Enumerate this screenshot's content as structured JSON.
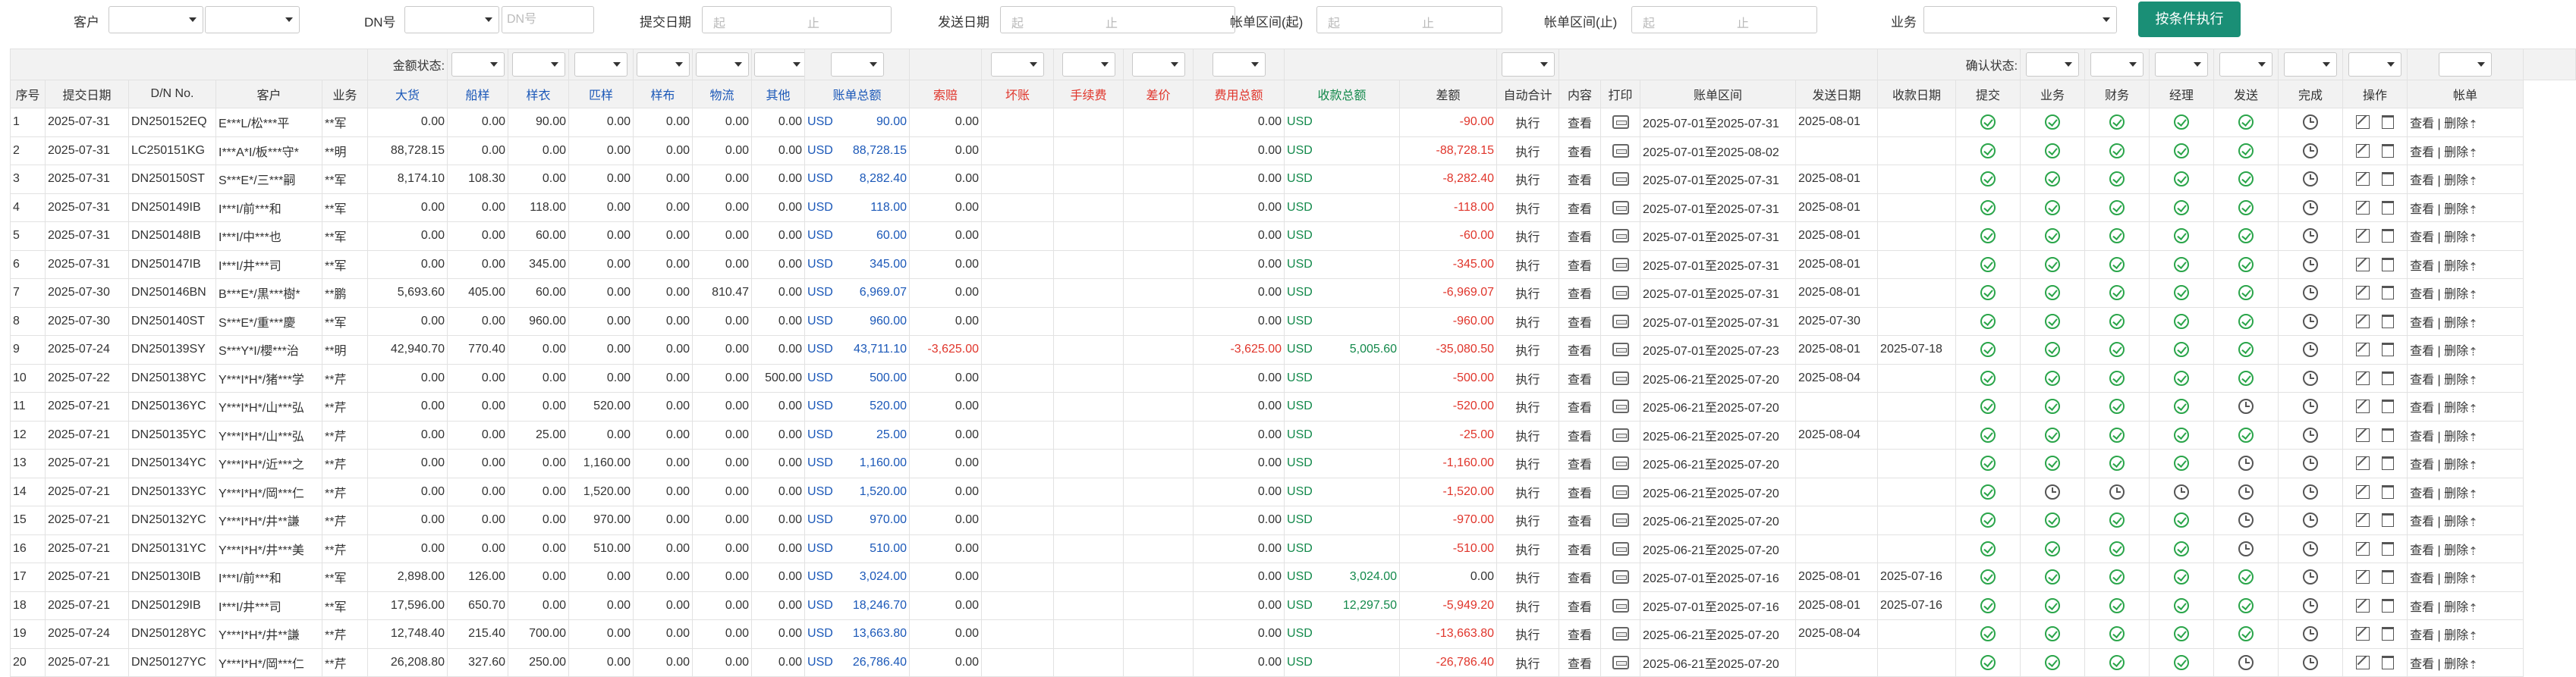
{
  "filters": {
    "customer_label": "客户",
    "dn_label": "DN号",
    "dn_placeholder": "DN号",
    "submit_date_label": "提交日期",
    "ship_date_label": "发送日期",
    "bill_start_label": "帐单区间(起)",
    "bill_end_label": "帐单区间(止)",
    "business_label": "业务",
    "range_from": "起",
    "range_to": "止",
    "execute_button": "按条件执行"
  },
  "header1": {
    "amount_status": "金额状态:",
    "confirm_status": "确认状态:"
  },
  "columns": {
    "seq": "序号",
    "submit_date": "提交日期",
    "dn": "D/N No.",
    "customer": "客户",
    "business": "业务",
    "bulk": "大货",
    "ship_sample": "船样",
    "sample": "样衣",
    "swatch": "匹样",
    "fabric_sample": "样布",
    "logistics": "物流",
    "other": "其他",
    "bill_total": "账单总额",
    "claim": "索赔",
    "bad_debt": "坏账",
    "fee": "手续费",
    "diff_price": "差价",
    "fee_total": "费用总额",
    "received_total": "收款总额",
    "balance": "差额",
    "auto_sum": "自动合计",
    "content": "内容",
    "print": "打印",
    "bill_range": "账单区间",
    "ship_date": "发送日期",
    "receive_date": "收款日期",
    "c_submit": "提交",
    "c_business": "业务",
    "c_finance": "财务",
    "c_manager": "经理",
    "c_send": "发送",
    "c_done": "完成",
    "ops": "操作",
    "statement": "帐单"
  },
  "labels": {
    "auto": "执行",
    "view": "查看",
    "op_text": "查看 | 删除",
    "currency": "USD"
  },
  "colors": {
    "accent": "#1a8f76",
    "blue": "#1b58b8",
    "red": "#e0352b",
    "green": "#13894b"
  },
  "rows": [
    {
      "seq": "1",
      "date": "2025-07-31",
      "dn": "DN250152EQ",
      "cust": "E***L/松***平",
      "biz": "**军",
      "bulk": "0.00",
      "ship": "0.00",
      "sample": "90.00",
      "swatch": "0.00",
      "fabric": "0.00",
      "log": "0.00",
      "other": "0.00",
      "total": "90.00",
      "claim": "0.00",
      "feetotal": "0.00",
      "recv": "",
      "bal": "-90.00",
      "range": "2025-07-01至2025-07-31",
      "ship_date": "2025-08-01",
      "recv_date": "",
      "status": [
        "c",
        "c",
        "c",
        "c",
        "c",
        "k"
      ]
    },
    {
      "seq": "2",
      "date": "2025-07-31",
      "dn": "LC250151KG",
      "cust": "I***A*I/板***守*",
      "biz": "**明",
      "bulk": "88,728.15",
      "ship": "0.00",
      "sample": "0.00",
      "swatch": "0.00",
      "fabric": "0.00",
      "log": "0.00",
      "other": "0.00",
      "total": "88,728.15",
      "claim": "0.00",
      "feetotal": "0.00",
      "recv": "",
      "bal": "-88,728.15",
      "range": "2025-07-01至2025-08-02",
      "ship_date": "",
      "recv_date": "",
      "status": [
        "c",
        "c",
        "c",
        "c",
        "c",
        "k"
      ]
    },
    {
      "seq": "3",
      "date": "2025-07-31",
      "dn": "DN250150ST",
      "cust": "S***E*/三***嗣",
      "biz": "**军",
      "bulk": "8,174.10",
      "ship": "108.30",
      "sample": "0.00",
      "swatch": "0.00",
      "fabric": "0.00",
      "log": "0.00",
      "other": "0.00",
      "total": "8,282.40",
      "claim": "0.00",
      "feetotal": "0.00",
      "recv": "",
      "bal": "-8,282.40",
      "range": "2025-07-01至2025-07-31",
      "ship_date": "2025-08-01",
      "recv_date": "",
      "status": [
        "c",
        "c",
        "c",
        "c",
        "c",
        "k"
      ]
    },
    {
      "seq": "4",
      "date": "2025-07-31",
      "dn": "DN250149IB",
      "cust": "I***I/前***和",
      "biz": "**军",
      "bulk": "0.00",
      "ship": "0.00",
      "sample": "118.00",
      "swatch": "0.00",
      "fabric": "0.00",
      "log": "0.00",
      "other": "0.00",
      "total": "118.00",
      "claim": "0.00",
      "feetotal": "0.00",
      "recv": "",
      "bal": "-118.00",
      "range": "2025-07-01至2025-07-31",
      "ship_date": "2025-08-01",
      "recv_date": "",
      "status": [
        "c",
        "c",
        "c",
        "c",
        "c",
        "k"
      ]
    },
    {
      "seq": "5",
      "date": "2025-07-31",
      "dn": "DN250148IB",
      "cust": "I***I/中***也",
      "biz": "**军",
      "bulk": "0.00",
      "ship": "0.00",
      "sample": "60.00",
      "swatch": "0.00",
      "fabric": "0.00",
      "log": "0.00",
      "other": "0.00",
      "total": "60.00",
      "claim": "0.00",
      "feetotal": "0.00",
      "recv": "",
      "bal": "-60.00",
      "range": "2025-07-01至2025-07-31",
      "ship_date": "2025-08-01",
      "recv_date": "",
      "status": [
        "c",
        "c",
        "c",
        "c",
        "c",
        "k"
      ]
    },
    {
      "seq": "6",
      "date": "2025-07-31",
      "dn": "DN250147IB",
      "cust": "I***I/井***司",
      "biz": "**军",
      "bulk": "0.00",
      "ship": "0.00",
      "sample": "345.00",
      "swatch": "0.00",
      "fabric": "0.00",
      "log": "0.00",
      "other": "0.00",
      "total": "345.00",
      "claim": "0.00",
      "feetotal": "0.00",
      "recv": "",
      "bal": "-345.00",
      "range": "2025-07-01至2025-07-31",
      "ship_date": "2025-08-01",
      "recv_date": "",
      "status": [
        "c",
        "c",
        "c",
        "c",
        "c",
        "k"
      ]
    },
    {
      "seq": "7",
      "date": "2025-07-30",
      "dn": "DN250146BN",
      "cust": "B***E*/黒***樹*",
      "biz": "**鹏",
      "bulk": "5,693.60",
      "ship": "405.00",
      "sample": "60.00",
      "swatch": "0.00",
      "fabric": "0.00",
      "log": "810.47",
      "other": "0.00",
      "total": "6,969.07",
      "claim": "0.00",
      "feetotal": "0.00",
      "recv": "",
      "bal": "-6,969.07",
      "range": "2025-07-01至2025-07-31",
      "ship_date": "2025-08-01",
      "recv_date": "",
      "status": [
        "c",
        "c",
        "c",
        "c",
        "c",
        "k"
      ]
    },
    {
      "seq": "8",
      "date": "2025-07-30",
      "dn": "DN250140ST",
      "cust": "S***E*/重***慶",
      "biz": "**军",
      "bulk": "0.00",
      "ship": "0.00",
      "sample": "960.00",
      "swatch": "0.00",
      "fabric": "0.00",
      "log": "0.00",
      "other": "0.00",
      "total": "960.00",
      "claim": "0.00",
      "feetotal": "0.00",
      "recv": "",
      "bal": "-960.00",
      "range": "2025-07-01至2025-07-31",
      "ship_date": "2025-07-30",
      "recv_date": "",
      "status": [
        "c",
        "c",
        "c",
        "c",
        "c",
        "k"
      ]
    },
    {
      "seq": "9",
      "date": "2025-07-24",
      "dn": "DN250139SY",
      "cust": "S***Y*I/櫻***治",
      "biz": "**明",
      "bulk": "42,940.70",
      "ship": "770.40",
      "sample": "0.00",
      "swatch": "0.00",
      "fabric": "0.00",
      "log": "0.00",
      "other": "0.00",
      "total": "43,711.10",
      "claim": "-3,625.00",
      "feetotal": "-3,625.00",
      "recv": "5,005.60",
      "bal": "-35,080.50",
      "range": "2025-07-01至2025-07-23",
      "ship_date": "2025-08-01",
      "recv_date": "2025-07-18",
      "status": [
        "c",
        "c",
        "c",
        "c",
        "c",
        "k"
      ]
    },
    {
      "seq": "10",
      "date": "2025-07-22",
      "dn": "DN250138YC",
      "cust": "Y***I*H*/猪***学",
      "biz": "**芹",
      "bulk": "0.00",
      "ship": "0.00",
      "sample": "0.00",
      "swatch": "0.00",
      "fabric": "0.00",
      "log": "0.00",
      "other": "500.00",
      "total": "500.00",
      "claim": "0.00",
      "feetotal": "0.00",
      "recv": "",
      "bal": "-500.00",
      "range": "2025-06-21至2025-07-20",
      "ship_date": "2025-08-04",
      "recv_date": "",
      "status": [
        "c",
        "c",
        "c",
        "c",
        "c",
        "k"
      ]
    },
    {
      "seq": "11",
      "date": "2025-07-21",
      "dn": "DN250136YC",
      "cust": "Y***I*H*/山***弘",
      "biz": "**芹",
      "bulk": "0.00",
      "ship": "0.00",
      "sample": "0.00",
      "swatch": "520.00",
      "fabric": "0.00",
      "log": "0.00",
      "other": "0.00",
      "total": "520.00",
      "claim": "0.00",
      "feetotal": "0.00",
      "recv": "",
      "bal": "-520.00",
      "range": "2025-06-21至2025-07-20",
      "ship_date": "",
      "recv_date": "",
      "status": [
        "c",
        "c",
        "c",
        "c",
        "k",
        "k"
      ]
    },
    {
      "seq": "12",
      "date": "2025-07-21",
      "dn": "DN250135YC",
      "cust": "Y***I*H*/山***弘",
      "biz": "**芹",
      "bulk": "0.00",
      "ship": "0.00",
      "sample": "25.00",
      "swatch": "0.00",
      "fabric": "0.00",
      "log": "0.00",
      "other": "0.00",
      "total": "25.00",
      "claim": "0.00",
      "feetotal": "0.00",
      "recv": "",
      "bal": "-25.00",
      "range": "2025-06-21至2025-07-20",
      "ship_date": "2025-08-04",
      "recv_date": "",
      "status": [
        "c",
        "c",
        "c",
        "c",
        "c",
        "k"
      ]
    },
    {
      "seq": "13",
      "date": "2025-07-21",
      "dn": "DN250134YC",
      "cust": "Y***I*H*/近***之",
      "biz": "**芹",
      "bulk": "0.00",
      "ship": "0.00",
      "sample": "0.00",
      "swatch": "1,160.00",
      "fabric": "0.00",
      "log": "0.00",
      "other": "0.00",
      "total": "1,160.00",
      "claim": "0.00",
      "feetotal": "0.00",
      "recv": "",
      "bal": "-1,160.00",
      "range": "2025-06-21至2025-07-20",
      "ship_date": "",
      "recv_date": "",
      "status": [
        "c",
        "c",
        "c",
        "c",
        "k",
        "k"
      ]
    },
    {
      "seq": "14",
      "date": "2025-07-21",
      "dn": "DN250133YC",
      "cust": "Y***I*H*/岡***仁",
      "biz": "**芹",
      "bulk": "0.00",
      "ship": "0.00",
      "sample": "0.00",
      "swatch": "1,520.00",
      "fabric": "0.00",
      "log": "0.00",
      "other": "0.00",
      "total": "1,520.00",
      "claim": "0.00",
      "feetotal": "0.00",
      "recv": "",
      "bal": "-1,520.00",
      "range": "2025-06-21至2025-07-20",
      "ship_date": "",
      "recv_date": "",
      "status": [
        "c",
        "k",
        "k",
        "k",
        "k",
        "k"
      ]
    },
    {
      "seq": "15",
      "date": "2025-07-21",
      "dn": "DN250132YC",
      "cust": "Y***I*H*/井**謙",
      "biz": "**芹",
      "bulk": "0.00",
      "ship": "0.00",
      "sample": "0.00",
      "swatch": "970.00",
      "fabric": "0.00",
      "log": "0.00",
      "other": "0.00",
      "total": "970.00",
      "claim": "0.00",
      "feetotal": "0.00",
      "recv": "",
      "bal": "-970.00",
      "range": "2025-06-21至2025-07-20",
      "ship_date": "",
      "recv_date": "",
      "status": [
        "c",
        "c",
        "c",
        "c",
        "k",
        "k"
      ]
    },
    {
      "seq": "16",
      "date": "2025-07-21",
      "dn": "DN250131YC",
      "cust": "Y***I*H*/井***美",
      "biz": "**芹",
      "bulk": "0.00",
      "ship": "0.00",
      "sample": "0.00",
      "swatch": "510.00",
      "fabric": "0.00",
      "log": "0.00",
      "other": "0.00",
      "total": "510.00",
      "claim": "0.00",
      "feetotal": "0.00",
      "recv": "",
      "bal": "-510.00",
      "range": "2025-06-21至2025-07-20",
      "ship_date": "",
      "recv_date": "",
      "status": [
        "c",
        "c",
        "c",
        "c",
        "k",
        "k"
      ]
    },
    {
      "seq": "17",
      "date": "2025-07-21",
      "dn": "DN250130IB",
      "cust": "I***I/前***和",
      "biz": "**军",
      "bulk": "2,898.00",
      "ship": "126.00",
      "sample": "0.00",
      "swatch": "0.00",
      "fabric": "0.00",
      "log": "0.00",
      "other": "0.00",
      "total": "3,024.00",
      "claim": "0.00",
      "feetotal": "0.00",
      "recv": "3,024.00",
      "bal": "0.00",
      "range": "2025-07-01至2025-07-16",
      "ship_date": "2025-08-01",
      "recv_date": "2025-07-16",
      "status": [
        "c",
        "c",
        "c",
        "c",
        "c",
        "k"
      ]
    },
    {
      "seq": "18",
      "date": "2025-07-21",
      "dn": "DN250129IB",
      "cust": "I***I/井***司",
      "biz": "**军",
      "bulk": "17,596.00",
      "ship": "650.70",
      "sample": "0.00",
      "swatch": "0.00",
      "fabric": "0.00",
      "log": "0.00",
      "other": "0.00",
      "total": "18,246.70",
      "claim": "0.00",
      "feetotal": "0.00",
      "recv": "12,297.50",
      "bal": "-5,949.20",
      "range": "2025-07-01至2025-07-16",
      "ship_date": "2025-08-01",
      "recv_date": "2025-07-16",
      "status": [
        "c",
        "c",
        "c",
        "c",
        "c",
        "k"
      ]
    },
    {
      "seq": "19",
      "date": "2025-07-24",
      "dn": "DN250128YC",
      "cust": "Y***I*H*/井**謙",
      "biz": "**芹",
      "bulk": "12,748.40",
      "ship": "215.40",
      "sample": "700.00",
      "swatch": "0.00",
      "fabric": "0.00",
      "log": "0.00",
      "other": "0.00",
      "total": "13,663.80",
      "claim": "0.00",
      "feetotal": "0.00",
      "recv": "",
      "bal": "-13,663.80",
      "range": "2025-06-21至2025-07-20",
      "ship_date": "2025-08-04",
      "recv_date": "",
      "status": [
        "c",
        "c",
        "c",
        "c",
        "c",
        "k"
      ]
    },
    {
      "seq": "20",
      "date": "2025-07-21",
      "dn": "DN250127YC",
      "cust": "Y***I*H*/岡***仁",
      "biz": "**芹",
      "bulk": "26,208.80",
      "ship": "327.60",
      "sample": "250.00",
      "swatch": "0.00",
      "fabric": "0.00",
      "log": "0.00",
      "other": "0.00",
      "total": "26,786.40",
      "claim": "0.00",
      "feetotal": "0.00",
      "recv": "",
      "bal": "-26,786.40",
      "range": "2025-06-21至2025-07-20",
      "ship_date": "",
      "recv_date": "",
      "status": [
        "c",
        "c",
        "c",
        "c",
        "k",
        "k"
      ]
    }
  ]
}
